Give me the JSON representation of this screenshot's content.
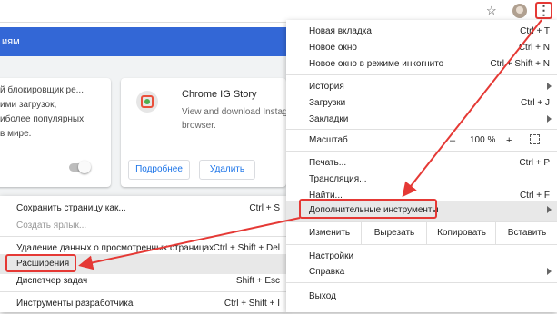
{
  "toolbar": {
    "star_icon": "star-icon",
    "menu_icon": "more-vert-icon"
  },
  "page": {
    "header_text": "иям",
    "card1": {
      "lines": [
        "й блокировщик ре...",
        "ими загрузок,",
        "иболее популярных",
        "в мире."
      ]
    },
    "card2": {
      "title": "Chrome IG Story",
      "desc": [
        "View and download Instag",
        "browser."
      ],
      "details_button": "Подробнее",
      "remove_button": "Удалить"
    }
  },
  "menu": {
    "new_tab": {
      "label": "Новая вкладка",
      "shortcut": "Ctrl + T"
    },
    "new_window": {
      "label": "Новое окно",
      "shortcut": "Ctrl + N"
    },
    "incognito": {
      "label": "Новое окно в режиме инкогнито",
      "shortcut": "Ctrl + Shift + N"
    },
    "history": {
      "label": "История"
    },
    "downloads": {
      "label": "Загрузки",
      "shortcut": "Ctrl + J"
    },
    "bookmarks": {
      "label": "Закладки"
    },
    "zoom": {
      "label": "Масштаб",
      "minus": "–",
      "value": "100 %",
      "plus": "+"
    },
    "print": {
      "label": "Печать...",
      "shortcut": "Ctrl + P"
    },
    "cast": {
      "label": "Трансляция..."
    },
    "find": {
      "label": "Найти...",
      "shortcut": "Ctrl + F"
    },
    "more_tools": {
      "label": "Дополнительные инструменты"
    },
    "edit": {
      "label": "Изменить",
      "cut": "Вырезать",
      "copy": "Копировать",
      "paste": "Вставить"
    },
    "settings": {
      "label": "Настройки"
    },
    "help": {
      "label": "Справка"
    },
    "exit": {
      "label": "Выход"
    }
  },
  "submenu": {
    "save_page": {
      "label": "Сохранить страницу как...",
      "shortcut": "Ctrl + S"
    },
    "create_shortcut": {
      "label": "Создать ярлык..."
    },
    "clear_data": {
      "label": "Удаление данных о просмотренных страницах...",
      "shortcut": "Ctrl + Shift + Del"
    },
    "extensions": {
      "label": "Расширения"
    },
    "task_manager": {
      "label": "Диспетчер задач",
      "shortcut": "Shift + Esc"
    },
    "dev_tools": {
      "label": "Инструменты разработчика",
      "shortcut": "Ctrl + Shift + I"
    }
  },
  "colors": {
    "header": "#3367d6",
    "highlight": "#e53935",
    "link": "#1a73e8"
  }
}
